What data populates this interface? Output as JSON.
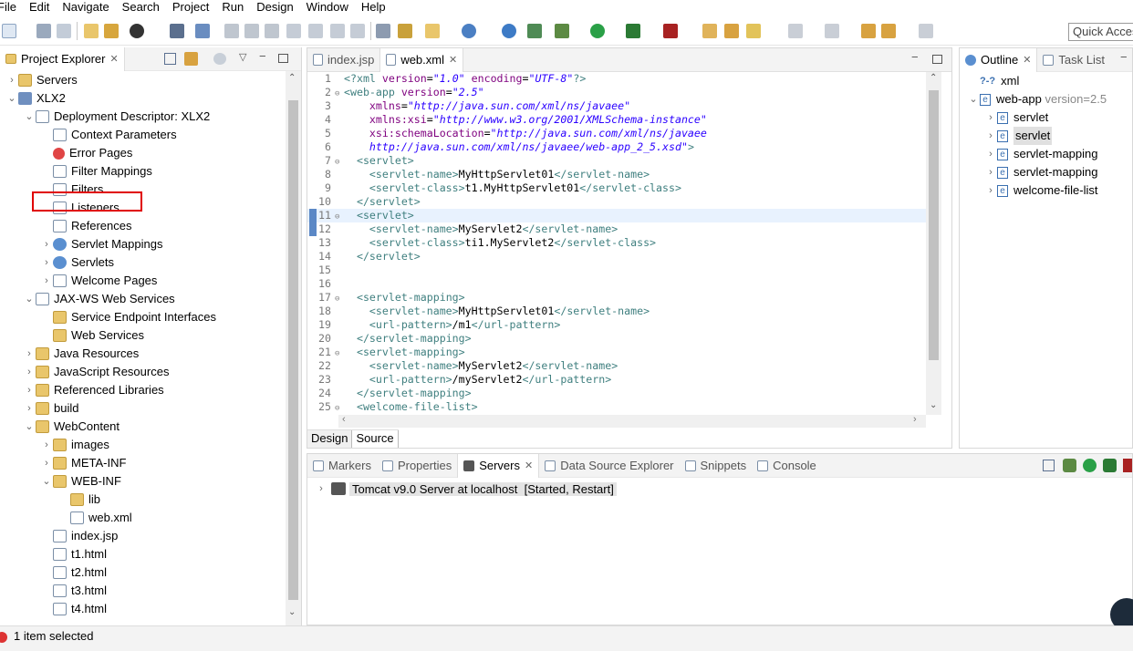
{
  "menu": [
    "File",
    "Edit",
    "Navigate",
    "Search",
    "Project",
    "Run",
    "Design",
    "Window",
    "Help"
  ],
  "quick_access": "Quick Access",
  "project_explorer": {
    "title": "Project Explorer",
    "items": [
      {
        "label": "Servers",
        "indent": 0,
        "chev": "›",
        "icon": "folder"
      },
      {
        "label": "XLX2",
        "indent": 0,
        "chev": "⌄",
        "icon": "proj"
      },
      {
        "label": "Deployment Descriptor: XLX2",
        "indent": 1,
        "chev": "⌄",
        "icon": "file"
      },
      {
        "label": "Context Parameters",
        "indent": 2,
        "chev": "",
        "icon": "file"
      },
      {
        "label": "Error Pages",
        "indent": 2,
        "chev": "",
        "icon": "error"
      },
      {
        "label": "Filter Mappings",
        "indent": 2,
        "chev": "",
        "icon": "file"
      },
      {
        "label": "Filters",
        "indent": 2,
        "chev": "",
        "icon": "file"
      },
      {
        "label": "Listeners",
        "indent": 2,
        "chev": "",
        "icon": "file"
      },
      {
        "label": "References",
        "indent": 2,
        "chev": "",
        "icon": "file"
      },
      {
        "label": "Servlet Mappings",
        "indent": 2,
        "chev": "›",
        "icon": "gear"
      },
      {
        "label": "Servlets",
        "indent": 2,
        "chev": "›",
        "icon": "gear"
      },
      {
        "label": "Welcome Pages",
        "indent": 2,
        "chev": "›",
        "icon": "file"
      },
      {
        "label": "JAX-WS Web Services",
        "indent": 1,
        "chev": "⌄",
        "icon": "file"
      },
      {
        "label": "Service Endpoint Interfaces",
        "indent": 2,
        "chev": "",
        "icon": "folder"
      },
      {
        "label": "Web Services",
        "indent": 2,
        "chev": "",
        "icon": "folder"
      },
      {
        "label": "Java Resources",
        "indent": 1,
        "chev": "›",
        "icon": "folder"
      },
      {
        "label": "JavaScript Resources",
        "indent": 1,
        "chev": "›",
        "icon": "folder"
      },
      {
        "label": "Referenced Libraries",
        "indent": 1,
        "chev": "›",
        "icon": "folder"
      },
      {
        "label": "build",
        "indent": 1,
        "chev": "›",
        "icon": "folder"
      },
      {
        "label": "WebContent",
        "indent": 1,
        "chev": "⌄",
        "icon": "folder"
      },
      {
        "label": "images",
        "indent": 2,
        "chev": "›",
        "icon": "folder"
      },
      {
        "label": "META-INF",
        "indent": 2,
        "chev": "›",
        "icon": "folder"
      },
      {
        "label": "WEB-INF",
        "indent": 2,
        "chev": "⌄",
        "icon": "folder"
      },
      {
        "label": "lib",
        "indent": 3,
        "chev": "",
        "icon": "folder"
      },
      {
        "label": "web.xml",
        "indent": 3,
        "chev": "",
        "icon": "file"
      },
      {
        "label": "index.jsp",
        "indent": 2,
        "chev": "",
        "icon": "file"
      },
      {
        "label": "t1.html",
        "indent": 2,
        "chev": "",
        "icon": "file"
      },
      {
        "label": "t2.html",
        "indent": 2,
        "chev": "",
        "icon": "file"
      },
      {
        "label": "t3.html",
        "indent": 2,
        "chev": "",
        "icon": "file"
      },
      {
        "label": "t4.html",
        "indent": 2,
        "chev": "",
        "icon": "file"
      }
    ]
  },
  "editor": {
    "tabs": [
      {
        "label": "index.jsp",
        "active": false
      },
      {
        "label": "web.xml",
        "active": true
      }
    ],
    "lines": [
      {
        "n": "1",
        "fold": "",
        "html": "<span class='tg'>&lt;?xml</span> <span class='an'>version</span>=<span class='av'>\"1.0\"</span> <span class='an'>encoding</span>=<span class='av'>\"UTF-8\"</span><span class='tg'>?&gt;</span>"
      },
      {
        "n": "2",
        "fold": "⊖",
        "html": "<span class='tg'>&lt;web-app</span> <span class='an'>version</span>=<span class='av'>\"2.5\"</span>"
      },
      {
        "n": "3",
        "fold": "",
        "html": "    <span class='an'>xmlns</span>=<span class='av'>\"http://java.sun.com/xml/ns/javaee\"</span>"
      },
      {
        "n": "4",
        "fold": "",
        "html": "    <span class='an'>xmlns:xsi</span>=<span class='av'>\"http://www.w3.org/2001/XMLSchema-instance\"</span>"
      },
      {
        "n": "5",
        "fold": "",
        "html": "    <span class='an'>xsi:schemaLocation</span>=<span class='av'>\"http://java.sun.com/xml/ns/javaee</span>"
      },
      {
        "n": "6",
        "fold": "",
        "html": "    <span class='av'>http://java.sun.com/xml/ns/javaee/web-app_2_5.xsd\"</span><span class='tg'>&gt;</span>"
      },
      {
        "n": "7",
        "fold": "⊖",
        "html": "  <span class='tg'>&lt;servlet&gt;</span>"
      },
      {
        "n": "8",
        "fold": "",
        "html": "    <span class='tg'>&lt;servlet-name&gt;</span>MyHttpServlet01<span class='tg'>&lt;/servlet-name&gt;</span>"
      },
      {
        "n": "9",
        "fold": "",
        "html": "    <span class='tg'>&lt;servlet-class&gt;</span>t1.MyHttpServlet01<span class='tg'>&lt;/servlet-class&gt;</span>"
      },
      {
        "n": "10",
        "fold": "",
        "html": "  <span class='tg'>&lt;/servlet&gt;</span>"
      },
      {
        "n": "11",
        "fold": "⊖",
        "html": "  <span class='tg'>&lt;servlet&gt;</span>",
        "cur": true
      },
      {
        "n": "12",
        "fold": "",
        "html": "    <span class='tg'>&lt;servlet-name&gt;</span>MyServlet2<span class='tg'>&lt;/servlet-name&gt;</span>"
      },
      {
        "n": "13",
        "fold": "",
        "html": "    <span class='tg'>&lt;servlet-class&gt;</span>ti1.MyServlet2<span class='tg'>&lt;/servlet-class&gt;</span>"
      },
      {
        "n": "14",
        "fold": "",
        "html": "  <span class='tg'>&lt;/servlet&gt;</span>"
      },
      {
        "n": "15",
        "fold": "",
        "html": ""
      },
      {
        "n": "16",
        "fold": "",
        "html": ""
      },
      {
        "n": "17",
        "fold": "⊖",
        "html": "  <span class='tg'>&lt;servlet-mapping&gt;</span>"
      },
      {
        "n": "18",
        "fold": "",
        "html": "    <span class='tg'>&lt;servlet-name&gt;</span>MyHttpServlet01<span class='tg'>&lt;/servlet-name&gt;</span>"
      },
      {
        "n": "19",
        "fold": "",
        "html": "    <span class='tg'>&lt;url-pattern&gt;</span>/m1<span class='tg'>&lt;/url-pattern&gt;</span>"
      },
      {
        "n": "20",
        "fold": "",
        "html": "  <span class='tg'>&lt;/servlet-mapping&gt;</span>"
      },
      {
        "n": "21",
        "fold": "⊖",
        "html": "  <span class='tg'>&lt;servlet-mapping&gt;</span>"
      },
      {
        "n": "22",
        "fold": "",
        "html": "    <span class='tg'>&lt;servlet-name&gt;</span>MyServlet2<span class='tg'>&lt;/servlet-name&gt;</span>"
      },
      {
        "n": "23",
        "fold": "",
        "html": "    <span class='tg'>&lt;url-pattern&gt;</span>/myServlet2<span class='tg'>&lt;/url-pattern&gt;</span>"
      },
      {
        "n": "24",
        "fold": "",
        "html": "  <span class='tg'>&lt;/servlet-mapping&gt;</span>"
      },
      {
        "n": "25",
        "fold": "⊖",
        "html": "  <span class='tg'>&lt;welcome-file-list&gt;</span>"
      }
    ],
    "bottom_tabs": [
      "Design",
      "Source"
    ]
  },
  "outline": {
    "tabs": [
      "Outline",
      "Task List"
    ],
    "items": [
      {
        "label": "xml",
        "suffix": "",
        "prefix": "?-?",
        "indent": 0,
        "chev": ""
      },
      {
        "label": "web-app",
        "suffix": " version=2.5",
        "prefix": "e",
        "indent": 0,
        "chev": "⌄"
      },
      {
        "label": "servlet",
        "suffix": "",
        "prefix": "e",
        "indent": 1,
        "chev": "›"
      },
      {
        "label": "servlet",
        "suffix": "",
        "prefix": "e",
        "indent": 1,
        "chev": "›",
        "selected": true
      },
      {
        "label": "servlet-mapping",
        "suffix": "",
        "prefix": "e",
        "indent": 1,
        "chev": "›"
      },
      {
        "label": "servlet-mapping",
        "suffix": "",
        "prefix": "e",
        "indent": 1,
        "chev": "›"
      },
      {
        "label": "welcome-file-list",
        "suffix": "",
        "prefix": "e",
        "indent": 1,
        "chev": "›"
      }
    ]
  },
  "bottom_panel": {
    "tabs": [
      "Markers",
      "Properties",
      "Servers",
      "Data Source Explorer",
      "Snippets",
      "Console"
    ],
    "active_tab": "Servers",
    "server_entry": "Tomcat v9.0 Server at localhost  [Started, Restart]"
  },
  "status": "1 item selected"
}
